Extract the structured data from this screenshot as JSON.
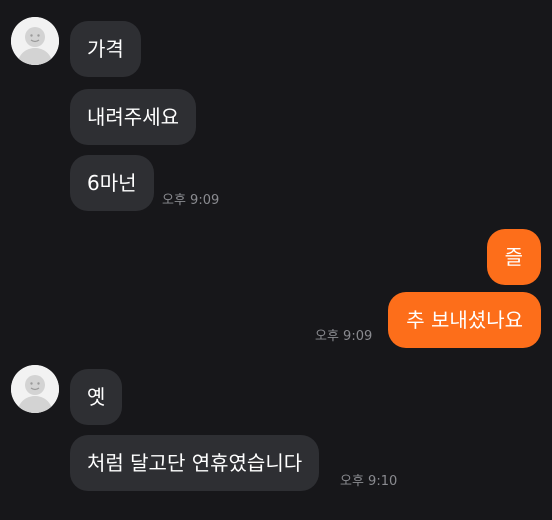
{
  "colors": {
    "background": "#17171a",
    "incoming_bubble": "#2e2f33",
    "outgoing_bubble": "#fd6e1a",
    "timestamp": "#8a8b90"
  },
  "messages": [
    {
      "side": "incoming",
      "text": "가격"
    },
    {
      "side": "incoming",
      "text": "내려주세요"
    },
    {
      "side": "incoming",
      "text": "6마넌",
      "time": "오후 9:09"
    },
    {
      "side": "outgoing",
      "text": "즐"
    },
    {
      "side": "outgoing",
      "text": "추 보내셨나요",
      "time": "오후 9:09"
    },
    {
      "side": "incoming",
      "text": "옛"
    },
    {
      "side": "incoming",
      "text": "처럼 달고단 연휴였습니다",
      "time": "오후 9:10"
    }
  ],
  "avatar_icon": "default-profile-icon"
}
